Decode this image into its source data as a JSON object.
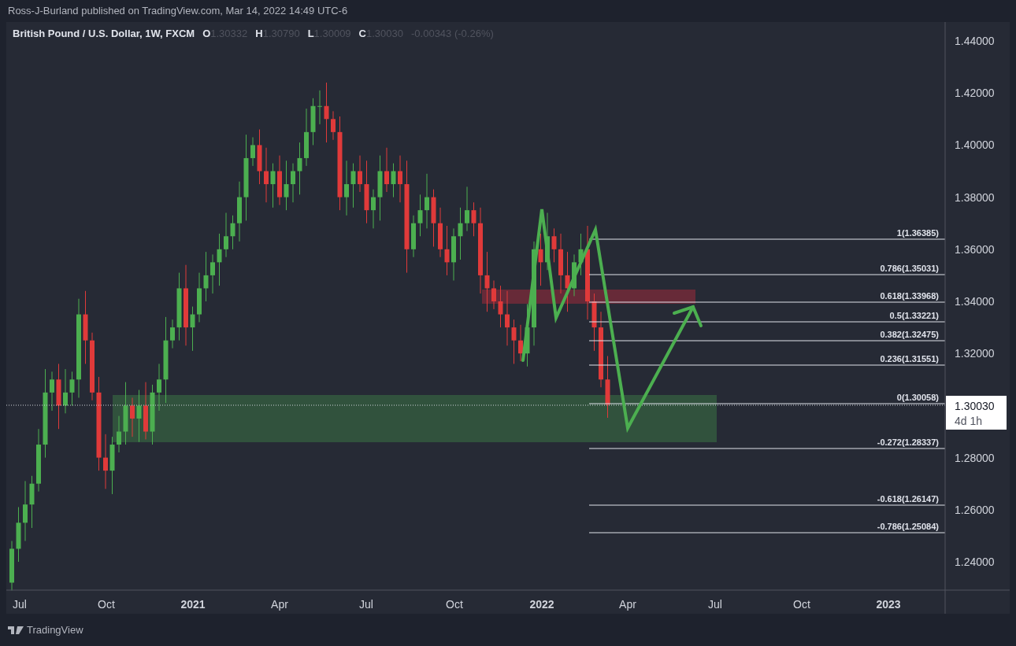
{
  "header": {
    "published": "Ross-J-Burland published on TradingView.com, Mar 14, 2022 14:49 UTC-6"
  },
  "legend": {
    "symbol": "British Pound / U.S. Dollar, 1W, FXCM",
    "ohlc": [
      {
        "key": "O",
        "value": "1.30332"
      },
      {
        "key": "H",
        "value": "1.30790"
      },
      {
        "key": "L",
        "value": "1.30009"
      },
      {
        "key": "C",
        "value": "1.30030"
      }
    ],
    "change": "-0.00343 (-0.26%)"
  },
  "price_axis": {
    "labels": [
      "1.44000",
      "1.42000",
      "1.40000",
      "1.38000",
      "1.36000",
      "1.34000",
      "1.32000",
      "1.28000",
      "1.26000",
      "1.24000"
    ]
  },
  "time_axis": {
    "labels": [
      {
        "text": "Jul",
        "bold": false
      },
      {
        "text": "Oct",
        "bold": false
      },
      {
        "text": "2021",
        "bold": true
      },
      {
        "text": "Apr",
        "bold": false
      },
      {
        "text": "Jul",
        "bold": false
      },
      {
        "text": "Oct",
        "bold": false
      },
      {
        "text": "2022",
        "bold": true
      },
      {
        "text": "Apr",
        "bold": false
      },
      {
        "text": "Jul",
        "bold": false
      },
      {
        "text": "Oct",
        "bold": false
      },
      {
        "text": "2023",
        "bold": true
      }
    ]
  },
  "fib_levels": [
    {
      "label": "1(1.36385)"
    },
    {
      "label": "0.786(1.35031)"
    },
    {
      "label": "0.618(1.33968)"
    },
    {
      "label": "0.5(1.33221)"
    },
    {
      "label": "0.382(1.32475)"
    },
    {
      "label": "0.236(1.31551)"
    },
    {
      "label": "0(1.30058)"
    },
    {
      "label": "-0.272(1.28337)"
    },
    {
      "label": "-0.618(1.26147)"
    },
    {
      "label": "-0.786(1.25084)"
    }
  ],
  "last_price": {
    "price": "1.30030",
    "countdown": "4d 1h"
  },
  "footer": {
    "brand": "TradingView"
  }
}
